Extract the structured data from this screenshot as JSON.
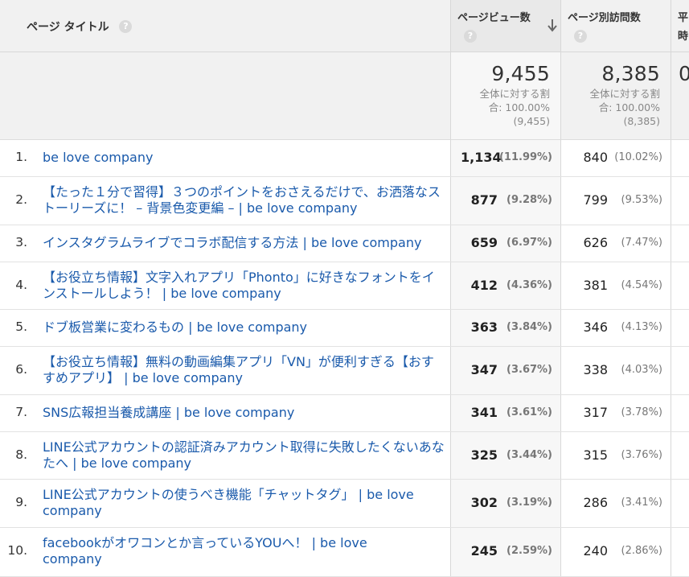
{
  "header": {
    "title_col": "ページ タイトル",
    "help_glyph": "?",
    "pv_col": "ページビュー数",
    "uv_col": "ページ別訪問数",
    "avg_col": "平\n時"
  },
  "summary": {
    "pv_total": "9,455",
    "pv_sub1": "全体に対する割",
    "pv_sub2": "合: 100.00%",
    "pv_sub3": "(9,455)",
    "uv_total": "8,385",
    "uv_sub1": "全体に対する割",
    "uv_sub2": "合: 100.00%",
    "uv_sub3": "(8,385)",
    "avg_total": "0"
  },
  "rows": [
    {
      "idx": "1.",
      "title": "be love company",
      "pv": "1,134",
      "pv_pct": "(11.99%)",
      "uv": "840",
      "uv_pct": "(10.02%)"
    },
    {
      "idx": "2.",
      "title": "【たった１分で習得】３つのポイントをおさえるだけで、お洒落なストーリーズに！ – 背景色変更編 – | be love company",
      "pv": "877",
      "pv_pct": "(9.28%)",
      "uv": "799",
      "uv_pct": "(9.53%)"
    },
    {
      "idx": "3.",
      "title": "インスタグラムライブでコラボ配信する方法 | be love company",
      "pv": "659",
      "pv_pct": "(6.97%)",
      "uv": "626",
      "uv_pct": "(7.47%)"
    },
    {
      "idx": "4.",
      "title": "【お役立ち情報】文字入れアプリ「Phonto」に好きなフォントをインストールしよう！ | be love company",
      "pv": "412",
      "pv_pct": "(4.36%)",
      "uv": "381",
      "uv_pct": "(4.54%)"
    },
    {
      "idx": "5.",
      "title": "ドブ板営業に変わるもの | be love company",
      "pv": "363",
      "pv_pct": "(3.84%)",
      "uv": "346",
      "uv_pct": "(4.13%)"
    },
    {
      "idx": "6.",
      "title": "【お役立ち情報】無料の動画編集アプリ「VN」が便利すぎる【おすすめアプリ】 | be love company",
      "pv": "347",
      "pv_pct": "(3.67%)",
      "uv": "338",
      "uv_pct": "(4.03%)"
    },
    {
      "idx": "7.",
      "title": "SNS広報担当養成講座 | be love company",
      "pv": "341",
      "pv_pct": "(3.61%)",
      "uv": "317",
      "uv_pct": "(3.78%)"
    },
    {
      "idx": "8.",
      "title": "LINE公式アカウントの認証済みアカウント取得に失敗したくないあなたへ | be love company",
      "pv": "325",
      "pv_pct": "(3.44%)",
      "uv": "315",
      "uv_pct": "(3.76%)"
    },
    {
      "idx": "9.",
      "title": "LINE公式アカウントの使うべき機能「チャットタグ」 | be love company",
      "pv": "302",
      "pv_pct": "(3.19%)",
      "uv": "286",
      "uv_pct": "(3.41%)"
    },
    {
      "idx": "10.",
      "title": "facebookがオワコンとか言っているYOUへ！ | be love company",
      "pv": "245",
      "pv_pct": "(2.59%)",
      "uv": "240",
      "uv_pct": "(2.86%)"
    }
  ]
}
